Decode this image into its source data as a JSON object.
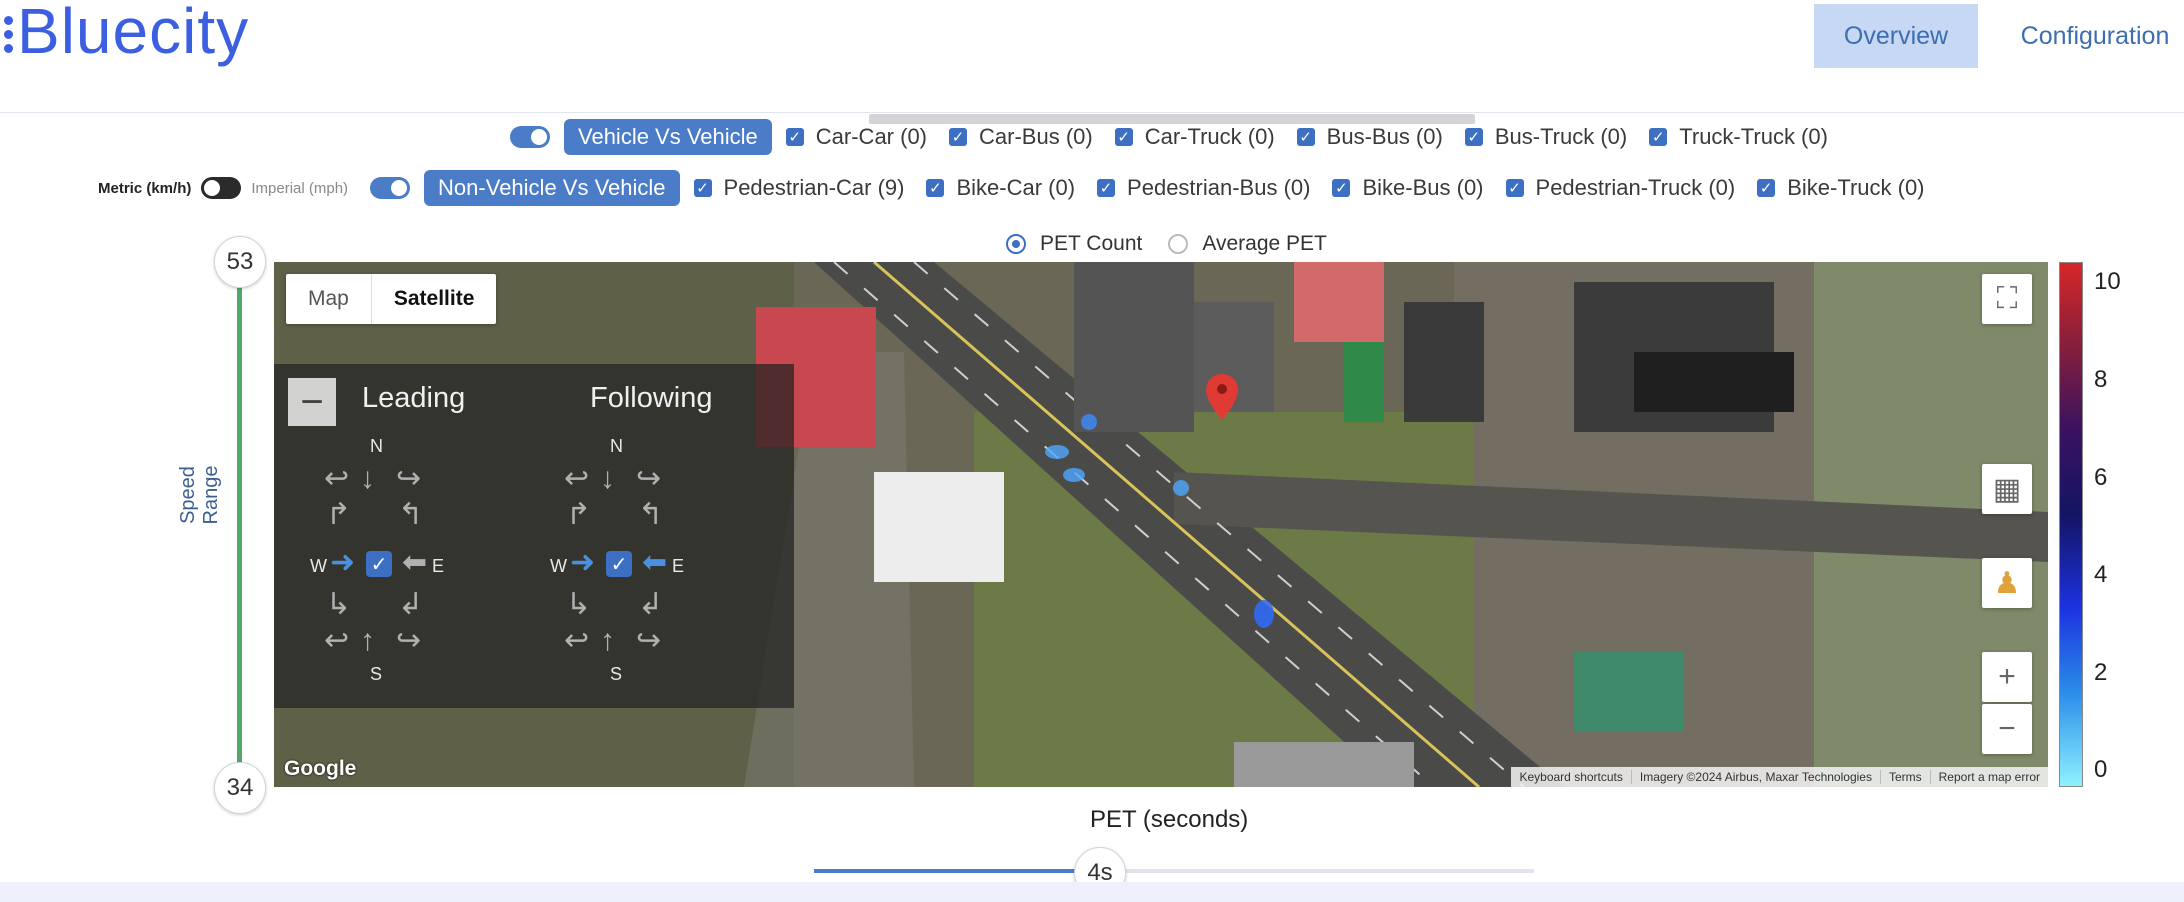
{
  "header": {
    "logo_text": "Bluecity",
    "nav": [
      {
        "label": "Overview",
        "active": true
      },
      {
        "label": "Configuration",
        "active": false
      }
    ]
  },
  "vehicle_row": {
    "group_label": "Vehicle Vs Vehicle",
    "items": [
      "Car-Car (0)",
      "Car-Bus (0)",
      "Car-Truck (0)",
      "Bus-Bus (0)",
      "Bus-Truck (0)",
      "Truck-Truck (0)"
    ]
  },
  "nonvehicle_row": {
    "units": {
      "metric": "Metric (km/h)",
      "imperial": "Imperial (mph)"
    },
    "group_label": "Non-Vehicle Vs Vehicle",
    "items": [
      "Pedestrian-Car (9)",
      "Bike-Car (0)",
      "Pedestrian-Bus (0)",
      "Bike-Bus (0)",
      "Pedestrian-Truck (0)",
      "Bike-Truck (0)"
    ]
  },
  "metric_options": [
    {
      "label": "PET Count",
      "selected": true
    },
    {
      "label": "Average PET",
      "selected": false
    }
  ],
  "speed_range": {
    "label": "Speed Range",
    "max": "53",
    "min": "34"
  },
  "map": {
    "types": [
      "Map",
      "Satellite"
    ],
    "selected_type": "Satellite",
    "leading": "Leading",
    "following": "Following",
    "compass": {
      "n": "N",
      "s": "S",
      "e": "E",
      "w": "W"
    },
    "google": "Google",
    "attribution": [
      "Keyboard shortcuts",
      "Imagery ©2024 Airbus, Maxar Technologies",
      "Terms",
      "Report a map error"
    ],
    "icons": [
      "fullscreen-icon",
      "layers-icon",
      "pegman-icon",
      "zoom-in-icon",
      "zoom-out-icon",
      "map-pin-icon"
    ]
  },
  "legend": {
    "ticks": [
      "10",
      "8",
      "6",
      "4",
      "2",
      "0"
    ],
    "colors": [
      "#d62728",
      "#3a1260",
      "#1c32e0",
      "#8ff2ff"
    ]
  },
  "pet": {
    "title": "PET (seconds)",
    "value_label": "4s",
    "fraction": 0.4
  }
}
